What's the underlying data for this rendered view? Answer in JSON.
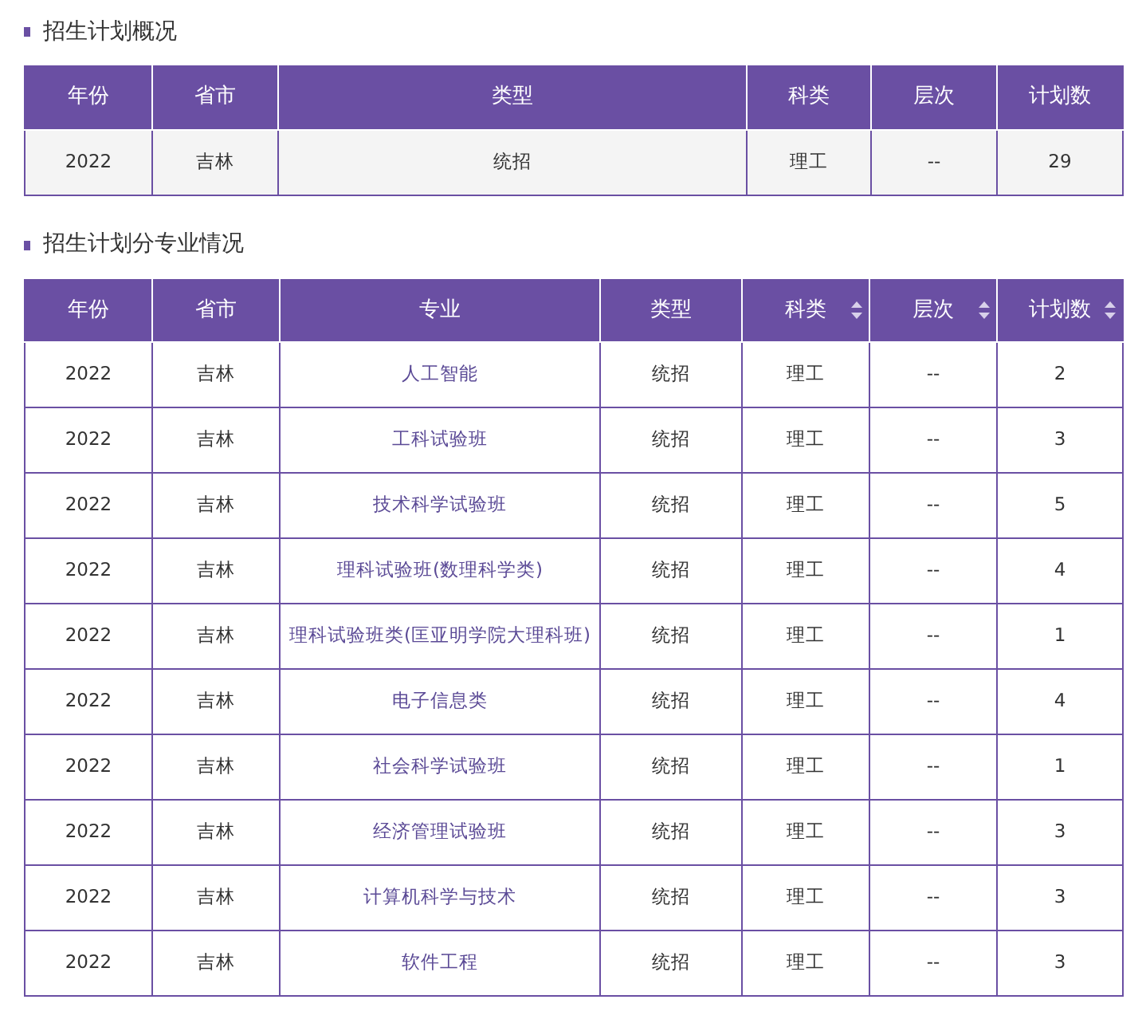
{
  "sections": [
    {
      "title": "招生计划概况",
      "kind": "summary",
      "columns": [
        {
          "label": "年份",
          "sortable": false,
          "kind": "plain"
        },
        {
          "label": "省市",
          "sortable": false,
          "kind": "plain"
        },
        {
          "label": "类型",
          "sortable": false,
          "kind": "plain"
        },
        {
          "label": "科类",
          "sortable": false,
          "kind": "plain"
        },
        {
          "label": "层次",
          "sortable": false,
          "kind": "plain"
        },
        {
          "label": "计划数",
          "sortable": false,
          "kind": "plain"
        }
      ],
      "rows": [
        [
          "2022",
          "吉林",
          "统招",
          "理工",
          "--",
          "29"
        ]
      ]
    },
    {
      "title": "招生计划分专业情况",
      "kind": "detail",
      "columns": [
        {
          "label": "年份",
          "sortable": false,
          "kind": "plain"
        },
        {
          "label": "省市",
          "sortable": false,
          "kind": "plain"
        },
        {
          "label": "专业",
          "sortable": false,
          "kind": "link"
        },
        {
          "label": "类型",
          "sortable": false,
          "kind": "plain"
        },
        {
          "label": "科类",
          "sortable": true,
          "kind": "plain"
        },
        {
          "label": "层次",
          "sortable": true,
          "kind": "plain"
        },
        {
          "label": "计划数",
          "sortable": true,
          "kind": "plain"
        }
      ],
      "rows": [
        [
          "2022",
          "吉林",
          "人工智能",
          "统招",
          "理工",
          "--",
          "2"
        ],
        [
          "2022",
          "吉林",
          "工科试验班",
          "统招",
          "理工",
          "--",
          "3"
        ],
        [
          "2022",
          "吉林",
          "技术科学试验班",
          "统招",
          "理工",
          "--",
          "5"
        ],
        [
          "2022",
          "吉林",
          "理科试验班(数理科学类)",
          "统招",
          "理工",
          "--",
          "4"
        ],
        [
          "2022",
          "吉林",
          "理科试验班类(匡亚明学院大理科班)",
          "统招",
          "理工",
          "--",
          "1"
        ],
        [
          "2022",
          "吉林",
          "电子信息类",
          "统招",
          "理工",
          "--",
          "4"
        ],
        [
          "2022",
          "吉林",
          "社会科学试验班",
          "统招",
          "理工",
          "--",
          "1"
        ],
        [
          "2022",
          "吉林",
          "经济管理试验班",
          "统招",
          "理工",
          "--",
          "3"
        ],
        [
          "2022",
          "吉林",
          "计算机科学与技术",
          "统招",
          "理工",
          "--",
          "3"
        ],
        [
          "2022",
          "吉林",
          "软件工程",
          "统招",
          "理工",
          "--",
          "3"
        ]
      ]
    }
  ]
}
